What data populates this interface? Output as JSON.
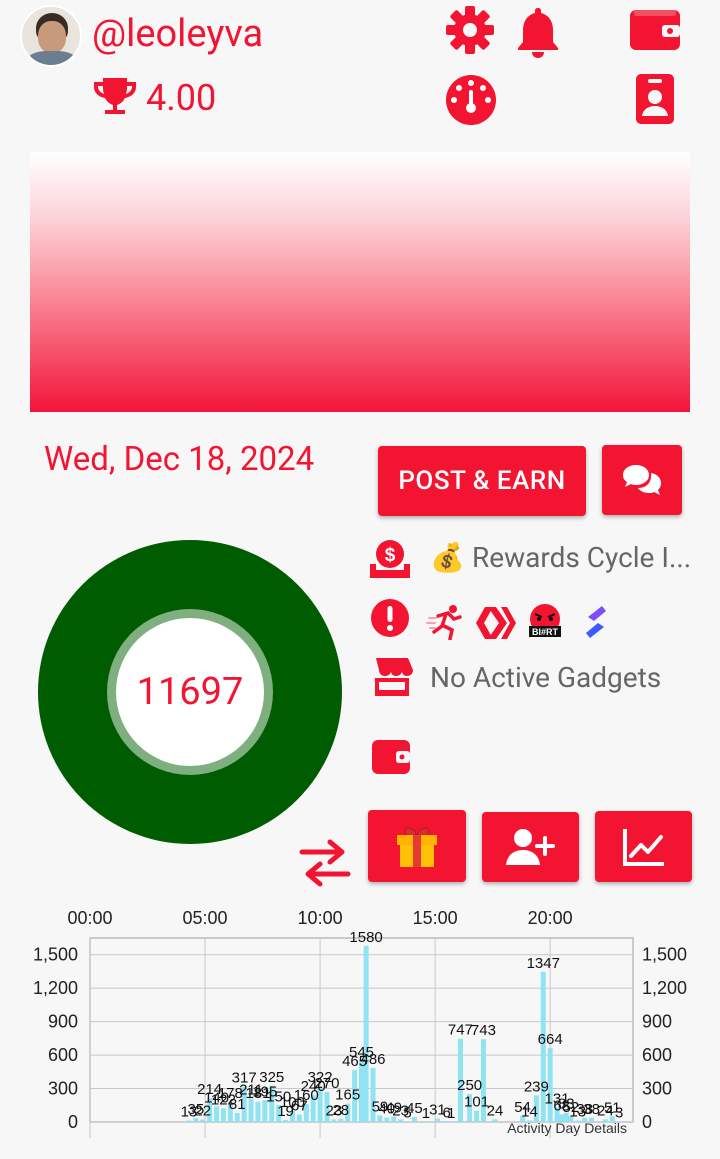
{
  "profile": {
    "username": "@leoleyva",
    "score": "4.00"
  },
  "date": "Wed, Dec 18, 2024",
  "buttons": {
    "post_earn": "POST & EARN"
  },
  "info": {
    "rewards_text": "Rewards Cycle I...",
    "rewards_emoji": "💰",
    "gadgets_text": "No Active Gadgets"
  },
  "gauge": {
    "value": "11697"
  },
  "colors": {
    "accent": "#f21431",
    "ring": "#005c00",
    "bar": "#8fe3f2"
  },
  "chart_data": {
    "type": "bar",
    "title": "",
    "footer_label": "Activity Day Details",
    "top_ticks": [
      "00:00",
      "05:00",
      "10:00",
      "15:00",
      "20:00"
    ],
    "y_ticks": [
      "0",
      "300",
      "600",
      "900",
      "1,200",
      "1,500"
    ],
    "ylim": [
      0,
      1650
    ],
    "xlim_hours": [
      0,
      23.6
    ],
    "bars": [
      {
        "h": 4.3,
        "v": 13,
        "l": "13"
      },
      {
        "h": 4.6,
        "v": 35,
        "l": "35"
      },
      {
        "h": 4.9,
        "v": 22,
        "l": "22"
      },
      {
        "h": 5.2,
        "v": 214,
        "l": "214"
      },
      {
        "h": 5.5,
        "v": 140,
        "l": "140"
      },
      {
        "h": 5.8,
        "v": 122,
        "l": "122"
      },
      {
        "h": 6.1,
        "v": 178,
        "l": "178"
      },
      {
        "h": 6.4,
        "v": 81,
        "l": "81"
      },
      {
        "h": 6.7,
        "v": 317,
        "l": "317"
      },
      {
        "h": 7.0,
        "v": 211,
        "l": "211"
      },
      {
        "h": 7.3,
        "v": 181,
        "l": "181"
      },
      {
        "h": 7.6,
        "v": 195,
        "l": "195"
      },
      {
        "h": 7.9,
        "v": 325,
        "l": "325"
      },
      {
        "h": 8.2,
        "v": 150,
        "l": "150"
      },
      {
        "h": 8.5,
        "v": 19,
        "l": "19"
      },
      {
        "h": 8.8,
        "v": 100,
        "l": "100"
      },
      {
        "h": 9.1,
        "v": 67,
        "l": "67"
      },
      {
        "h": 9.4,
        "v": 160,
        "l": "160"
      },
      {
        "h": 9.7,
        "v": 240,
        "l": "240"
      },
      {
        "h": 10.0,
        "v": 322,
        "l": "322"
      },
      {
        "h": 10.3,
        "v": 270,
        "l": "270"
      },
      {
        "h": 10.6,
        "v": 23,
        "l": "23"
      },
      {
        "h": 10.9,
        "v": 28,
        "l": "28"
      },
      {
        "h": 11.2,
        "v": 165,
        "l": "165"
      },
      {
        "h": 11.5,
        "v": 465,
        "l": "465"
      },
      {
        "h": 11.8,
        "v": 545,
        "l": "545"
      },
      {
        "h": 12.0,
        "v": 1580,
        "l": "1580"
      },
      {
        "h": 12.3,
        "v": 486,
        "l": "486"
      },
      {
        "h": 12.6,
        "v": 59,
        "l": "59"
      },
      {
        "h": 12.9,
        "v": 40,
        "l": "40"
      },
      {
        "h": 13.2,
        "v": 49,
        "l": "49"
      },
      {
        "h": 13.5,
        "v": 23,
        "l": "23"
      },
      {
        "h": 13.8,
        "v": 5,
        "l": "5"
      },
      {
        "h": 14.1,
        "v": 45,
        "l": "45"
      },
      {
        "h": 14.6,
        "v": 1,
        "l": "1"
      },
      {
        "h": 15.1,
        "v": 31,
        "l": "31"
      },
      {
        "h": 15.5,
        "v": 6,
        "l": "6"
      },
      {
        "h": 15.7,
        "v": 1,
        "l": "1"
      },
      {
        "h": 16.1,
        "v": 747,
        "l": "747"
      },
      {
        "h": 16.5,
        "v": 250,
        "l": "250"
      },
      {
        "h": 16.8,
        "v": 101,
        "l": "101"
      },
      {
        "h": 17.1,
        "v": 743,
        "l": "743"
      },
      {
        "h": 17.6,
        "v": 24,
        "l": "24"
      },
      {
        "h": 18.8,
        "v": 54,
        "l": "54"
      },
      {
        "h": 19.1,
        "v": 14,
        "l": "14"
      },
      {
        "h": 19.4,
        "v": 239,
        "l": "239"
      },
      {
        "h": 19.7,
        "v": 1347,
        "l": "1347"
      },
      {
        "h": 20.0,
        "v": 664,
        "l": "664"
      },
      {
        "h": 20.3,
        "v": 131,
        "l": "131"
      },
      {
        "h": 20.5,
        "v": 68,
        "l": "68"
      },
      {
        "h": 20.7,
        "v": 83,
        "l": "83"
      },
      {
        "h": 20.9,
        "v": 52,
        "l": "52"
      },
      {
        "h": 21.2,
        "v": 13,
        "l": "13"
      },
      {
        "h": 21.5,
        "v": 38,
        "l": "38"
      },
      {
        "h": 21.8,
        "v": 38,
        "l": "38"
      },
      {
        "h": 22.4,
        "v": 24,
        "l": "24"
      },
      {
        "h": 22.7,
        "v": 51,
        "l": "51"
      },
      {
        "h": 23.0,
        "v": 3,
        "l": "3"
      }
    ]
  }
}
